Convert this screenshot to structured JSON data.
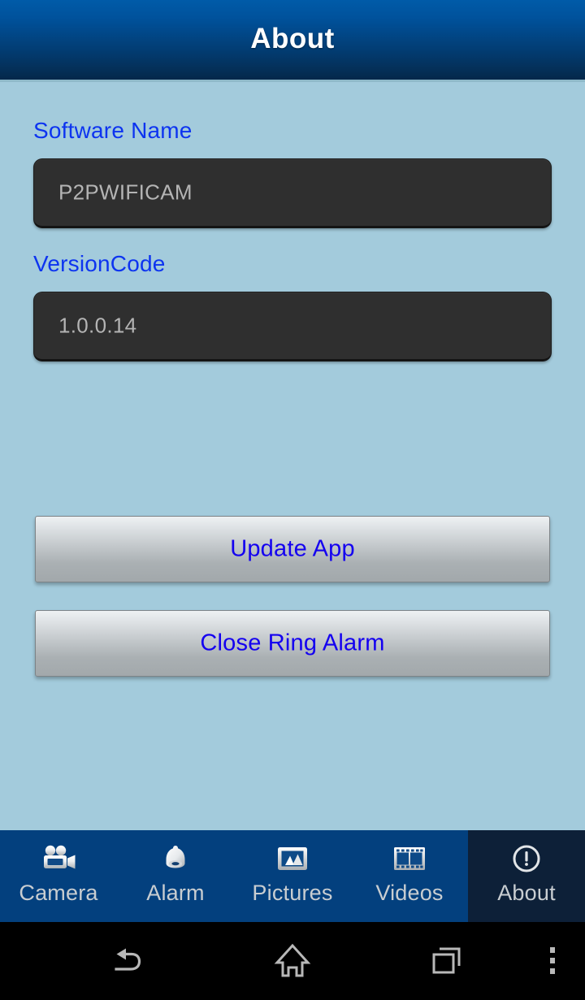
{
  "titlebar": {
    "title": "About"
  },
  "form": {
    "fields": [
      {
        "label": "Software Name",
        "value": "P2PWIFICAM",
        "placeholder": "Software Name"
      },
      {
        "label": "VersionCode",
        "value": "1.0.0.14",
        "placeholder": "VersionCode"
      }
    ]
  },
  "actions": {
    "buttons": [
      {
        "label": "Update App"
      },
      {
        "label": "Close Ring Alarm"
      }
    ]
  },
  "tabbar": {
    "active_index": 4,
    "items": [
      {
        "label": "Camera",
        "icon": "video-camera-icon",
        "active": false
      },
      {
        "label": "Alarm",
        "icon": "bell-icon",
        "active": false
      },
      {
        "label": "Pictures",
        "icon": "image-icon",
        "active": false
      },
      {
        "label": "Videos",
        "icon": "film-strip-icon",
        "active": false
      },
      {
        "label": "About",
        "icon": "info-circle-icon",
        "active": true
      }
    ]
  },
  "navbar": {
    "items": [
      {
        "name": "back",
        "icon": "back-arrow-icon"
      },
      {
        "name": "home",
        "icon": "home-icon"
      },
      {
        "name": "recents",
        "icon": "recents-icon"
      },
      {
        "name": "menu",
        "icon": "overflow-menu-icon"
      }
    ]
  },
  "colors": {
    "background": "#a3cbdc",
    "titlebar_top": "#005ba8",
    "titlebar_bottom": "#04274a",
    "label_blue": "#0d34f0",
    "button_text_blue": "#1400f0",
    "field_dark": "#2f2f2f",
    "field_text": "#b4b4b4",
    "tab_inactive": "#03407e",
    "tab_active": "#0d2038",
    "tab_label": "#c8cdd1",
    "navbar": "#000000"
  }
}
